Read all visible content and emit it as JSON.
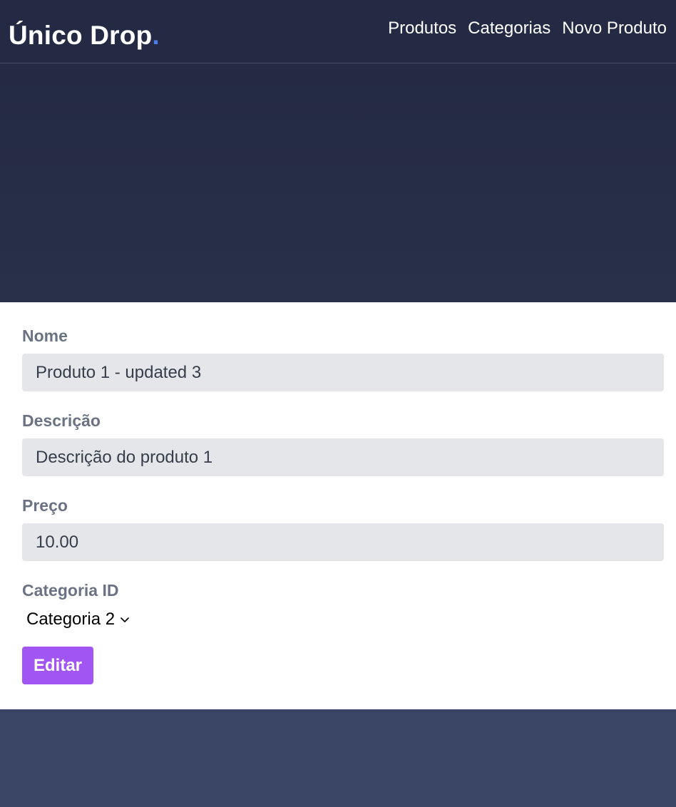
{
  "header": {
    "brand": "Único Drop",
    "brand_dot": ".",
    "nav": [
      "Produtos",
      "Categorias",
      "Novo Produto"
    ]
  },
  "form": {
    "name_label": "Nome",
    "name_value": "Produto 1 - updated 3",
    "description_label": "Descrição",
    "description_value": "Descrição do produto 1",
    "price_label": "Preço",
    "price_value": "10.00",
    "category_label": "Categoria ID",
    "category_selected": "Categoria 2",
    "submit_label": "Editar"
  },
  "colors": {
    "navbar": "#242a44",
    "accent_dot": "#4f7be8",
    "submit_button": "#a155f2",
    "footer": "#3a4566"
  },
  "icons": {
    "select_chevron": "chevron-down-icon"
  }
}
